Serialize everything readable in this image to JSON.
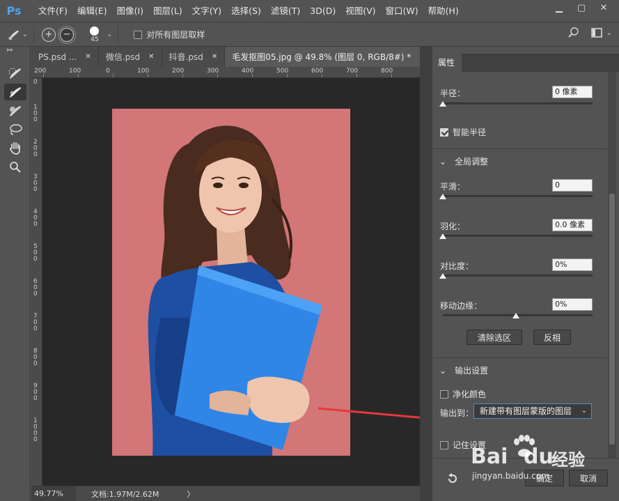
{
  "app": {
    "logo": "Ps"
  },
  "menu": [
    "文件(F)",
    "编辑(E)",
    "图像(I)",
    "图层(L)",
    "文字(Y)",
    "选择(S)",
    "滤镜(T)",
    "3D(D)",
    "视图(V)",
    "窗口(W)",
    "帮助(H)"
  ],
  "options": {
    "brush_size": "45",
    "sample_all_layers_label": "对所有图层取样",
    "sample_all_layers_checked": false
  },
  "tabs": [
    {
      "label": "PS.psd ...",
      "active": false
    },
    {
      "label": "微信.psd",
      "active": false
    },
    {
      "label": "抖音.psd",
      "active": false
    },
    {
      "label": "毛发抠图05.jpg @ 49.8% (图层 0, RGB/8#) *",
      "active": true
    }
  ],
  "ruler": {
    "h": [
      "200",
      "100",
      "0",
      "100",
      "200",
      "300",
      "400",
      "500",
      "600",
      "700",
      "800"
    ],
    "v": [
      "0",
      "1\n0\n0",
      "2\n0\n0",
      "3\n0\n0",
      "4\n0\n0",
      "5\n0\n0",
      "6\n0\n0",
      "7\n0\n0",
      "8\n0\n0",
      "9\n0\n0",
      "1\n0\n0\n0"
    ]
  },
  "status": {
    "zoom": "49.77%",
    "doc": "文档:1.97M/2.62M",
    "arrow": "〉"
  },
  "panel": {
    "tab": "属性",
    "radius": {
      "label": "半径：",
      "value": "0 像素",
      "level": 0
    },
    "smart_radius": {
      "label": "智能半径",
      "checked": true
    },
    "global": {
      "title": "全局调整",
      "smooth": {
        "label": "平滑：",
        "value": "0",
        "level": 0
      },
      "feather": {
        "label": "羽化：",
        "value": "0.0 像素",
        "level": 0
      },
      "contrast": {
        "label": "对比度：",
        "value": "0%",
        "level": 0
      },
      "shift_edge": {
        "label": "移动边缘：",
        "value": "0%",
        "level": 0.5
      },
      "clear_selection": "清除选区",
      "invert": "反相"
    },
    "output": {
      "title": "输出设置",
      "decontaminate": {
        "label": "净化颜色",
        "checked": false
      },
      "output_to_label": "输出到：",
      "output_to_value": "新建带有图层蒙版的图层",
      "remember": {
        "label": "记住设置",
        "checked": false
      }
    },
    "ok": "确定",
    "cancel": "取消"
  },
  "watermark": {
    "brand": "Bai",
    "brand2": "du",
    "cn": "经验",
    "url": "jingyan.baidu.com"
  },
  "colors": {
    "accent": "#4aa3f0",
    "photo_bg": "#d27677",
    "shirt": "#1e4fa3",
    "folder": "#2f86e6",
    "arrow": "#e8373a"
  }
}
